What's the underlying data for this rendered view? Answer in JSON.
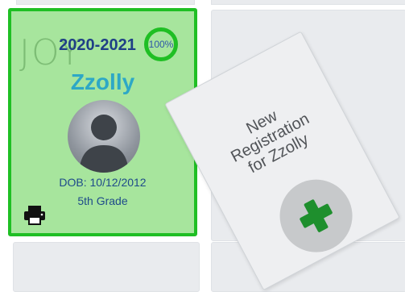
{
  "student_card": {
    "watermark": "JOY",
    "school_year": "2020-2021",
    "completion": "100%",
    "name": "Zzolly",
    "dob": "DOB: 10/12/2012",
    "grade": "5th Grade"
  },
  "new_registration": {
    "label": "New Registration for Zzolly"
  },
  "icons": {
    "printer": "printer-icon",
    "plus": "plus-icon",
    "avatar": "person-silhouette-icon"
  },
  "colors": {
    "card_green": "#a7e59d",
    "border_green": "#1fbf24",
    "year_blue": "#1f3f86",
    "name_teal": "#2da8c6",
    "plus_green": "#1e8f2d"
  }
}
